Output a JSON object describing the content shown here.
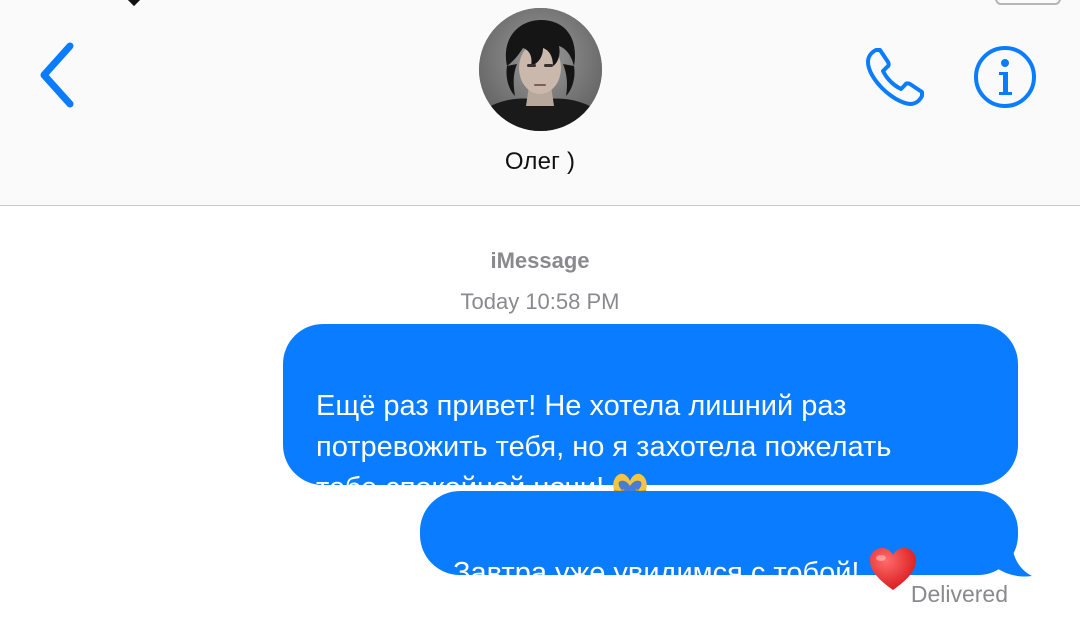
{
  "header": {
    "contact_name": "Олег )",
    "back_icon": "chevron-left-icon",
    "phone_icon": "phone-icon",
    "info_icon": "info-icon",
    "accent_color": "#0a7cff"
  },
  "thread": {
    "service_label": "iMessage",
    "timestamp": "Today 10:58 PM",
    "messages": [
      {
        "text": "Ещё раз привет! Не хотела лишний раз\nпотревожить тебя, но я захотела пожелать\nтебе спокойной ночи!",
        "emoji": "heart-hands-emoji",
        "sender": "me"
      },
      {
        "text": "Завтра уже увидимся с тобой!",
        "emoji": "red-heart-emoji",
        "sender": "me"
      }
    ],
    "status": "Delivered",
    "bubble_color": "#0a7cff",
    "meta_text_color": "#8a8a8e"
  }
}
